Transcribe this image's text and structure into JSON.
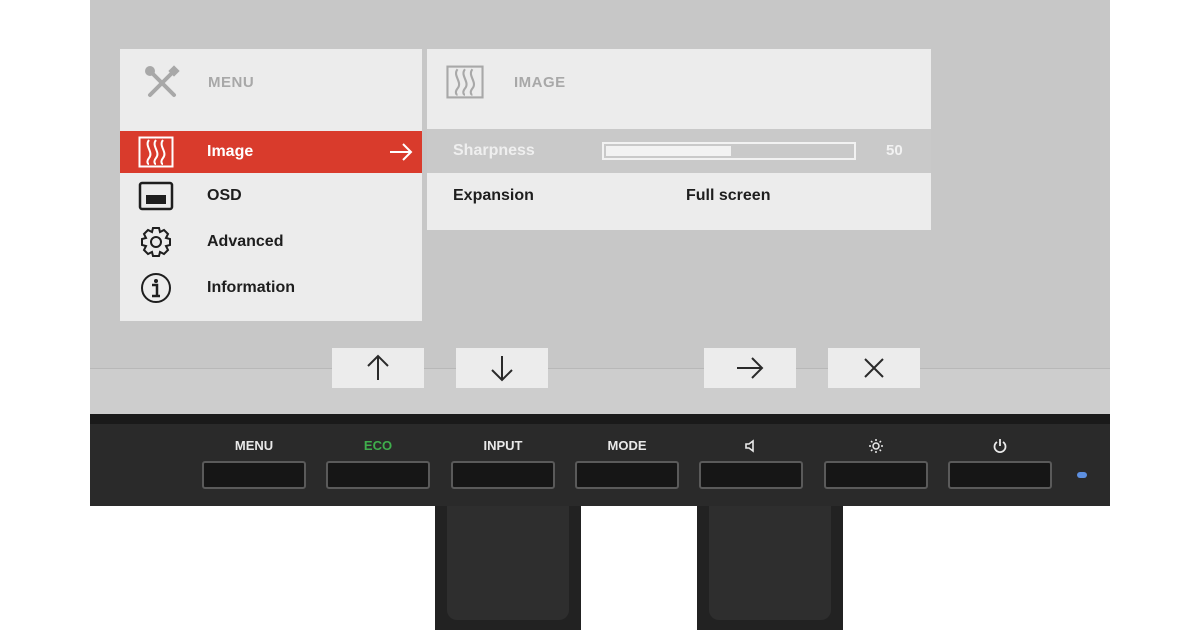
{
  "menu": {
    "header": {
      "icon": "wrench-screwdriver-icon",
      "label": "MENU"
    },
    "items": [
      {
        "icon": "image-waves-icon",
        "label": "Image",
        "selected": true,
        "arrow": "arrow-right-icon"
      },
      {
        "icon": "monitor-osd-icon",
        "label": "OSD"
      },
      {
        "icon": "gear-icon",
        "label": "Advanced"
      },
      {
        "icon": "info-icon",
        "label": "Information"
      }
    ]
  },
  "submenu": {
    "header": {
      "icon": "image-waves-icon",
      "label": "IMAGE"
    },
    "rows": [
      {
        "label": "Sharpness",
        "type": "slider",
        "value": "50",
        "fill_fraction": 0.5,
        "disabled": true
      },
      {
        "label": "Expansion",
        "type": "value",
        "value": "Full screen"
      }
    ]
  },
  "hints": [
    {
      "icon": "arrow-up-icon"
    },
    {
      "icon": "arrow-down-icon"
    },
    {
      "icon": "arrow-right-icon"
    },
    {
      "icon": "close-icon"
    }
  ],
  "hardware_buttons": [
    {
      "label": "MENU"
    },
    {
      "label": "ECO",
      "color": "#3fae4c"
    },
    {
      "label": "INPUT"
    },
    {
      "label": "MODE"
    },
    {
      "label": "",
      "icon": "speaker-icon"
    },
    {
      "label": "",
      "icon": "brightness-icon"
    },
    {
      "label": "",
      "icon": "power-icon"
    }
  ],
  "led": {
    "color": "#5d8fe0"
  },
  "colors": {
    "selection": "#d93b2c",
    "panel": "#ececec",
    "screen": "#c7c7c7",
    "bezel": "#2a2a2a"
  }
}
